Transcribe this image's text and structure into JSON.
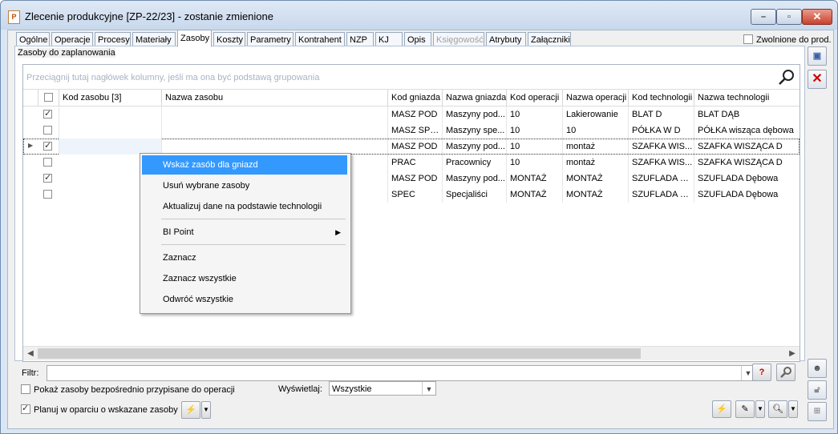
{
  "window": {
    "title": "Zlecenie produkcyjne  [ZP-22/23] - zostanie zmienione",
    "app_icon": "P"
  },
  "tabs": [
    {
      "label": "Ogólne"
    },
    {
      "label": "Operacje"
    },
    {
      "label": "Procesy"
    },
    {
      "label": "Materiały"
    },
    {
      "label": "Zasoby"
    },
    {
      "label": "Koszty"
    },
    {
      "label": "Parametry"
    },
    {
      "label": "Kontrahent"
    },
    {
      "label": "NZP"
    },
    {
      "label": "KJ"
    },
    {
      "label": "Opis"
    },
    {
      "label": "Księgowość"
    },
    {
      "label": "Atrybuty"
    },
    {
      "label": "Załączniki"
    }
  ],
  "zwolnione": {
    "label": "Zwolnione do prod.",
    "checked": false
  },
  "section_label": "Zasoby do zaplanowania",
  "group_hint": "Przeciągnij tutaj nagłówek kolumny, jeśli ma ona być podstawą grupowania",
  "columns": [
    "Kod zasobu [3]",
    "Nazwa zasobu",
    "Kod gniazda",
    "Nazwa gniazda",
    "Kod operacji",
    "Nazwa operacji",
    "Kod technologii",
    "Nazwa technologii"
  ],
  "rows": [
    {
      "checked": true,
      "kod_gniazda": "MASZ POD",
      "nazwa_gniazda": "Maszyny pod...",
      "kod_operacji": "10",
      "nazwa_operacji": "Lakierowanie",
      "kod_techn": "BLAT D",
      "nazwa_techn": "BLAT DĄB"
    },
    {
      "checked": false,
      "kod_gniazda": "MASZ SPEC",
      "nazwa_gniazda": "Maszyny spe...",
      "kod_operacji": "10",
      "nazwa_operacji": "10",
      "kod_techn": "PÓŁKA W D",
      "nazwa_techn": "PÓŁKA wisząca dębowa"
    },
    {
      "checked": true,
      "kod_gniazda": "MASZ POD",
      "nazwa_gniazda": "Maszyny pod...",
      "kod_operacji": "10",
      "nazwa_operacji": "montaż",
      "kod_techn": "SZAFKA WIS...",
      "nazwa_techn": "SZAFKA WISZĄCA D"
    },
    {
      "checked": false,
      "kod_gniazda": "PRAC",
      "nazwa_gniazda": "Pracownicy",
      "kod_operacji": "10",
      "nazwa_operacji": "montaż",
      "kod_techn": "SZAFKA WIS...",
      "nazwa_techn": "SZAFKA WISZĄCA D"
    },
    {
      "checked": true,
      "kod_gniazda": "MASZ POD",
      "nazwa_gniazda": "Maszyny pod...",
      "kod_operacji": "MONTAŻ",
      "nazwa_operacji": "MONTAŻ",
      "kod_techn": "SZUFLADA D...",
      "nazwa_techn": "SZUFLADA Dębowa"
    },
    {
      "checked": false,
      "kod_gniazda": "SPEC",
      "nazwa_gniazda": "Specjaliści",
      "kod_operacji": "MONTAŻ",
      "nazwa_operacji": "MONTAŻ",
      "kod_techn": "SZUFLADA D...",
      "nazwa_techn": "SZUFLADA Dębowa"
    }
  ],
  "context_menu": {
    "items": [
      "Wskaż zasób dla gniazd",
      "Usuń wybrane zasoby",
      "Aktualizuj dane na podstawie technologii",
      "BI Point",
      "Zaznacz",
      "Zaznacz wszystkie",
      "Odwróć wszystkie"
    ],
    "highlight_color": "#3399ff"
  },
  "filter": {
    "label": "Filtr:",
    "value": ""
  },
  "pokaz": {
    "label": "Pokaż zasoby bezpośrednio przypisane do operacji",
    "checked": false
  },
  "wyswietlaj": {
    "label": "Wyświetlaj:",
    "value": "Wszystkie"
  },
  "planuj": {
    "label": "Planuj w oparciu o wskazane zasoby",
    "checked": true
  },
  "colors": {
    "accent": "#3399ff",
    "title_bg": "#dbe6f4",
    "close_btn": "#c8432e"
  }
}
